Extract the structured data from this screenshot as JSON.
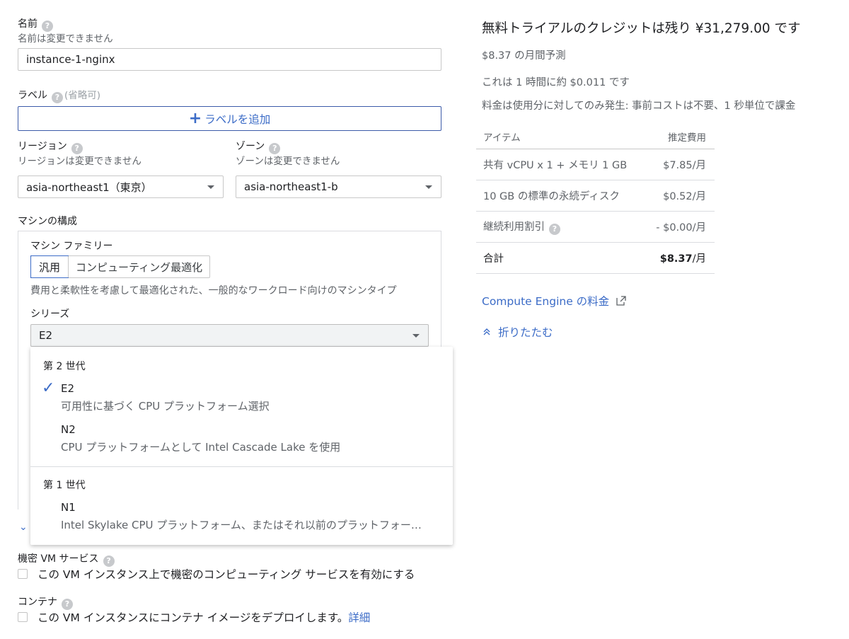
{
  "name": {
    "label": "名前",
    "sub": "名前は変更できません",
    "value": "instance-1-nginx"
  },
  "labels": {
    "label": "ラベル",
    "optional": "(省略可)",
    "add_button": "ラベルを追加"
  },
  "region": {
    "label": "リージョン",
    "sub": "リージョンは変更できません",
    "value": "asia-northeast1（東京）"
  },
  "zone": {
    "label": "ゾーン",
    "sub": "ゾーンは変更できません",
    "value": "asia-northeast1-b"
  },
  "machine_config": {
    "label": "マシンの構成",
    "family_label": "マシン ファミリー",
    "family_tabs": [
      "汎用",
      "コンピューティング最適化"
    ],
    "family_desc": "費用と柔軟性を考慮して最適化された、一般的なワークロード向けのマシンタイプ",
    "series_label": "シリーズ",
    "series_value": "E2"
  },
  "series_dropdown": {
    "gen2_header": "第 2 世代",
    "gen1_header": "第 1 世代",
    "items": [
      {
        "name": "E2",
        "desc": "可用性に基づく CPU プラットフォーム選択",
        "selected": true
      },
      {
        "name": "N2",
        "desc": "CPU プラットフォームとして Intel Cascade Lake を使用",
        "selected": false
      },
      {
        "name": "N1",
        "desc": "Intel Skylake CPU プラットフォーム、またはそれ以前のプラットフォー…",
        "selected": false
      }
    ]
  },
  "confidential": {
    "label": "機密 VM サービス",
    "checkbox_label": "この VM インスタンス上で機密のコンピューティング サービスを有効にする"
  },
  "container": {
    "label": "コンテナ",
    "checkbox_label": "この VM インスタンスにコンテナ イメージをデプロイします。",
    "link": "詳細"
  },
  "pricing": {
    "credit_text": "無料トライアルのクレジットは残り ¥31,279.00 です",
    "monthly_estimate": "$8.37 の月間予測",
    "hourly": "これは 1 時間に約 $0.011 です",
    "note": "料金は使用分に対してのみ発生: 事前コストは不要、1 秒単位で課金",
    "table": {
      "col_item": "アイテム",
      "col_cost": "推定費用",
      "rows": [
        {
          "item": "共有 vCPU x 1 + メモリ 1 GB",
          "cost": "$7.85/月"
        },
        {
          "item": "10 GB の標準の永続ディスク",
          "cost": "$0.52/月"
        },
        {
          "item": "継続利用割引",
          "cost": "- $0.00/月"
        }
      ],
      "total_label": "合計",
      "total_value": "$8.37",
      "total_unit": "/月"
    },
    "pricing_link": "Compute Engine の料金",
    "collapse": "折りたたむ"
  }
}
